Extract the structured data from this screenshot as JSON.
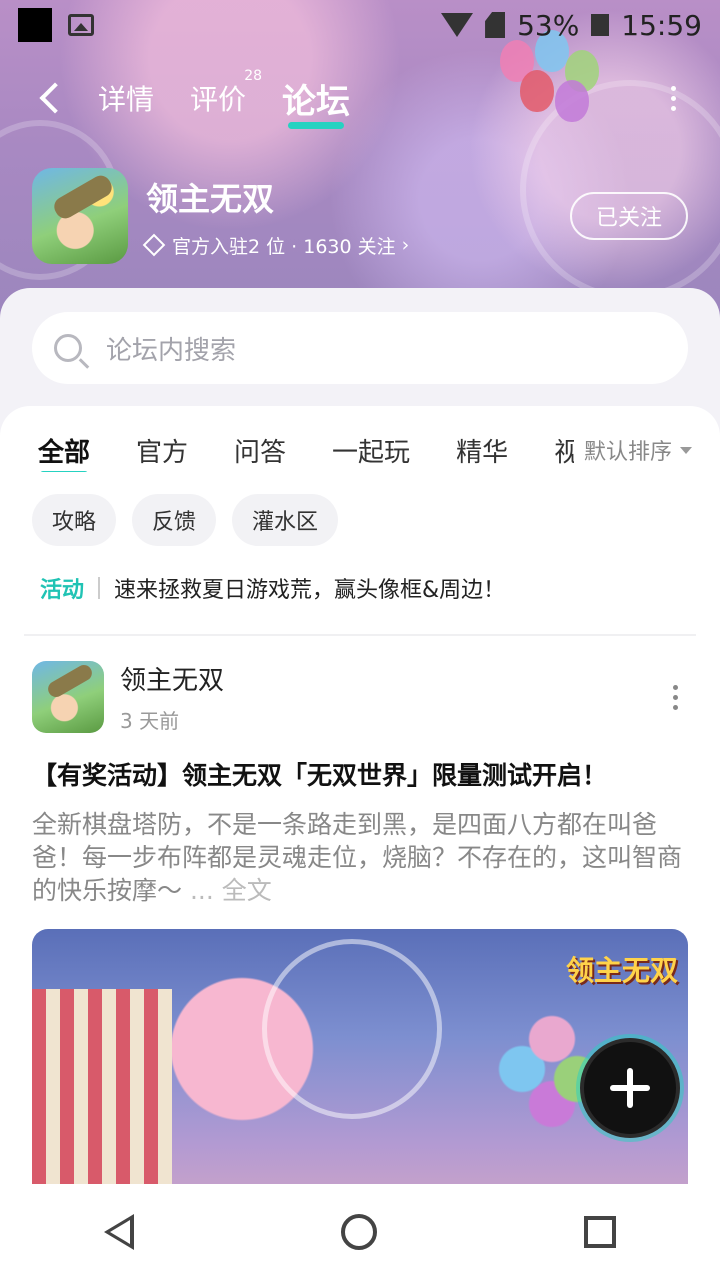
{
  "status_bar": {
    "battery_percent": "53%",
    "time": "15:59",
    "icons": [
      "notification-square-icon",
      "image-icon",
      "wifi-off-icon",
      "no-sim-icon",
      "battery-icon"
    ]
  },
  "top_nav": {
    "tabs": [
      {
        "label": "详情",
        "badge": ""
      },
      {
        "label": "评价",
        "badge": "28"
      },
      {
        "label": "论坛",
        "badge": ""
      }
    ],
    "active_tab": "论坛"
  },
  "game": {
    "name": "领主无双",
    "meta": "官方入驻2 位 · 1630 关注",
    "follow_label": "已关注"
  },
  "search": {
    "placeholder": "论坛内搜索"
  },
  "categories": {
    "items": [
      "全部",
      "官方",
      "问答",
      "一起玩",
      "精华",
      "视"
    ],
    "active": "全部",
    "sort_label": "默认排序"
  },
  "chips": [
    "攻略",
    "反馈",
    "灌水区"
  ],
  "announcement": {
    "tag": "活动",
    "text": "速来拯救夏日游戏荒，赢头像框&周边！"
  },
  "post": {
    "author": "领主无双",
    "time": "3 天前",
    "title": "【有奖活动】领主无双「无双世界」限量测试开启！",
    "body": "全新棋盘塔防，不是一条路走到黑，是四面八方都在叫爸爸！每一步布阵都是灵魂走位，烧脑？不存在的，这叫智商的快乐按摩～",
    "ellipsis": "...",
    "full_text_label": "全文",
    "image_logo": "领主无双"
  }
}
